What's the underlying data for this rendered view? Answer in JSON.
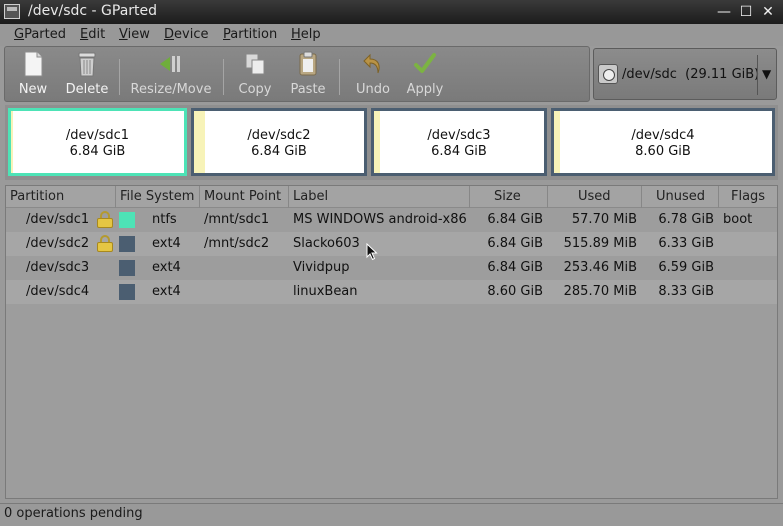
{
  "window": {
    "title": "/dev/sdc - GParted",
    "minimize": "—",
    "maximize": "☐",
    "close": "✕"
  },
  "menu": [
    {
      "key": "G",
      "rest": "Parted"
    },
    {
      "key": "E",
      "rest": "dit"
    },
    {
      "key": "V",
      "rest": "iew"
    },
    {
      "key": "D",
      "rest": "evice"
    },
    {
      "key": "P",
      "rest": "artition"
    },
    {
      "key": "H",
      "rest": "elp"
    }
  ],
  "toolbar": {
    "new": "New",
    "delete": "Delete",
    "resize": "Resize/Move",
    "copy": "Copy",
    "paste": "Paste",
    "undo": "Undo",
    "apply": "Apply"
  },
  "device": {
    "name": "/dev/sdc",
    "size": "(29.11 GiB)",
    "icon": "disk-icon"
  },
  "graph": [
    {
      "name": "/dev/sdc1",
      "size": "6.84 GiB"
    },
    {
      "name": "/dev/sdc2",
      "size": "6.84 GiB"
    },
    {
      "name": "/dev/sdc3",
      "size": "6.84 GiB"
    },
    {
      "name": "/dev/sdc4",
      "size": "8.60 GiB"
    }
  ],
  "columns": {
    "partition": "Partition",
    "filesystem": "File System",
    "mount": "Mount Point",
    "label": "Label",
    "size": "Size",
    "used": "Used",
    "unused": "Unused",
    "flags": "Flags"
  },
  "rows": [
    {
      "partition": "/dev/sdc1",
      "locked": true,
      "color": "#4de3b6",
      "fs": "ntfs",
      "mount": "/mnt/sdc1",
      "label": "MS WINDOWS android-x86",
      "size": "6.84 GiB",
      "used": "57.70 MiB",
      "unused": "6.78 GiB",
      "flags": "boot"
    },
    {
      "partition": "/dev/sdc2",
      "locked": true,
      "color": "#4b5e71",
      "fs": "ext4",
      "mount": "/mnt/sdc2",
      "label": "Slacko603",
      "size": "6.84 GiB",
      "used": "515.89 MiB",
      "unused": "6.33 GiB",
      "flags": ""
    },
    {
      "partition": "/dev/sdc3",
      "locked": false,
      "color": "#4b5e71",
      "fs": "ext4",
      "mount": "",
      "label": "Vividpup",
      "size": "6.84 GiB",
      "used": "253.46 MiB",
      "unused": "6.59 GiB",
      "flags": ""
    },
    {
      "partition": "/dev/sdc4",
      "locked": false,
      "color": "#4b5e71",
      "fs": "ext4",
      "mount": "",
      "label": "linuxBean",
      "size": "8.60 GiB",
      "used": "285.70 MiB",
      "unused": "8.33 GiB",
      "flags": ""
    }
  ],
  "status": "0 operations pending"
}
